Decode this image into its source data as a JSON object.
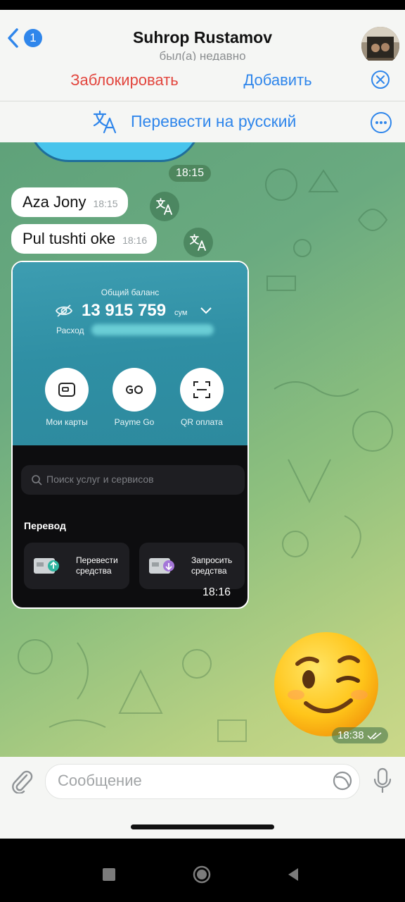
{
  "header": {
    "back_badge": "1",
    "title": "Suhrop Rustamov",
    "subtitle": "был(а) недавно"
  },
  "action_bar": {
    "block_label": "Заблокировать",
    "add_label": "Добавить"
  },
  "translate_bar": {
    "label": "Перевести на русский"
  },
  "messages": [
    {
      "type": "time",
      "text": "18:15"
    },
    {
      "type": "text",
      "text": "Aza Jony",
      "time": "18:15"
    },
    {
      "type": "text",
      "text": "Pul tushti oke",
      "time": "18:16"
    },
    {
      "type": "image",
      "time": "18:16",
      "screenshot": {
        "balance_label": "Общий баланс",
        "balance_amount": "13 915 759",
        "currency": "сум",
        "expense_label": "Расход",
        "quick_actions": [
          "Мои карты",
          "Payme Go",
          "QR оплата"
        ],
        "search_placeholder": "Поиск услуг и сервисов",
        "section_title": "Перевод",
        "transfer_cards": [
          {
            "line1": "Перевести",
            "line2": "средства"
          },
          {
            "line1": "Запросить",
            "line2": "средства"
          }
        ]
      }
    },
    {
      "type": "sticker",
      "icon": "winking-face-emoji",
      "time": "18:38",
      "status": "read-double-check"
    }
  ],
  "composer": {
    "placeholder": "Сообщение"
  },
  "colors": {
    "accent": "#2f86eb",
    "danger": "#e2463e"
  }
}
